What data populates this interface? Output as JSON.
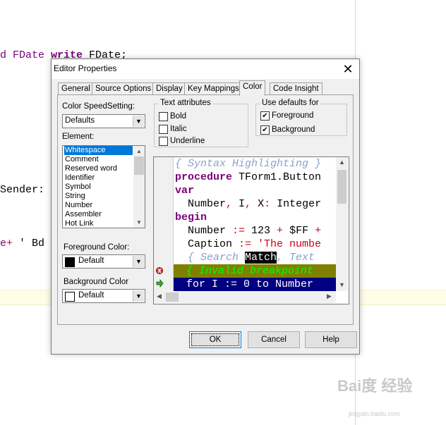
{
  "background_code": {
    "line1_prefix": "d FDate ",
    "line1_write": "write",
    "line1_suffix": " FDate;",
    "line2": "Sender:",
    "line3_prefix": "e",
    "line3_plus": "+",
    "line3_suffix": " ' Bd"
  },
  "dialog": {
    "title": "Editor Properties",
    "close_glyph": "✕",
    "tabs": [
      "General",
      "Source Options",
      "Display",
      "Key Mappings",
      "Color",
      "Code Insight"
    ],
    "active_tab": "Color"
  },
  "color_speed": {
    "label": "Color SpeedSetting:",
    "value": "Defaults"
  },
  "element": {
    "label": "Element:",
    "items": [
      "Whitespace",
      "Comment",
      "Reserved word",
      "Identifier",
      "Symbol",
      "String",
      "Number",
      "Assembler",
      "Hot Link"
    ],
    "selected": "Whitespace"
  },
  "foreground_color": {
    "label": "Foreground Color:",
    "value": "Default",
    "swatch": "#000000"
  },
  "background_color": {
    "label": "Background Color",
    "value": "Default",
    "swatch": "#ffffff"
  },
  "text_attributes": {
    "label": "Text attributes",
    "bold": "Bold",
    "italic": "Italic",
    "underline": "Underline"
  },
  "use_defaults": {
    "label": "Use defaults for",
    "foreground": "Foreground",
    "background": "Background"
  },
  "preview": {
    "comment": "{ Syntax Highlighting }",
    "proc_kw": "procedure",
    "proc_rest": " TForm1.Button",
    "var_kw": "var",
    "decl_a": "  Number",
    "decl_comma1": ",",
    "decl_b": " I",
    "decl_comma2": ",",
    "decl_c": " X",
    "decl_colon": ":",
    "decl_d": " Integer",
    "begin_kw": "begin",
    "num_a": "  Number ",
    "num_assign": ":=",
    "num_val": " 123 ",
    "num_plus": "+",
    "num_hex": " $FF ",
    "num_plus2": "+",
    "cap_a": "  Caption ",
    "cap_assign": ":=",
    "cap_str": " 'The numbe",
    "search_a": "  { Search ",
    "search_match": "Match",
    "search_b": ", Text",
    "invalid": "  { Invalid breakpoint",
    "for_line": "  for I := 0 to Number"
  },
  "buttons": {
    "ok": "OK",
    "cancel": "Cancel",
    "help": "Help"
  },
  "colors": {
    "selection_blue": "#0078d7",
    "keyword_purple": "#7a0078",
    "symbol_red": "#d0001c",
    "comment_blue_grey": "#8ca0c8",
    "invalid_bg": "#808000",
    "invalid_fg": "#00ff00",
    "exec_bg": "#000080"
  },
  "watermark": {
    "brand": "Bai度 经验",
    "url": "jingyan.baidu.com"
  }
}
